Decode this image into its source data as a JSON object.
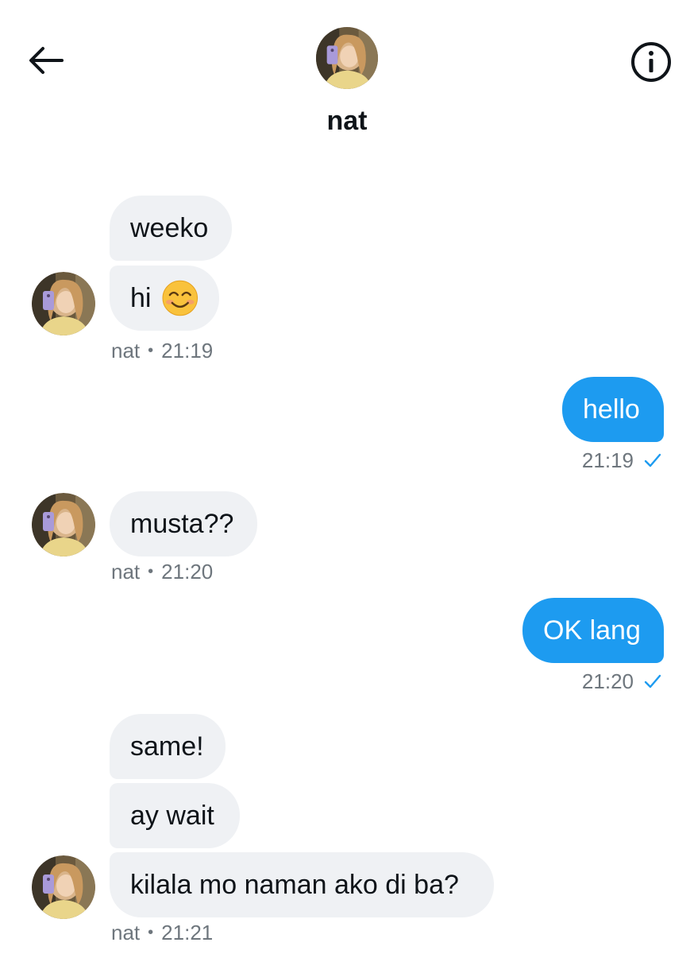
{
  "header": {
    "contact_name": "nat",
    "back_icon": "arrow-left-icon",
    "info_icon": "info-circle-icon"
  },
  "colors": {
    "outgoing_bubble": "#1d9bf0",
    "incoming_bubble": "#eff1f4",
    "meta_text": "#6e767d",
    "read_check": "#1d9bf0"
  },
  "messages": [
    {
      "direction": "in",
      "text": "weeko"
    },
    {
      "direction": "in",
      "text": "hi",
      "emoji": "smiling-face-icon"
    },
    {
      "direction": "in",
      "meta": {
        "sender": "nat",
        "time": "21:19"
      }
    },
    {
      "direction": "out",
      "text": "hello",
      "meta": {
        "time": "21:19",
        "status": "sent"
      }
    },
    {
      "direction": "in",
      "text": "musta??",
      "meta": {
        "sender": "nat",
        "time": "21:20"
      }
    },
    {
      "direction": "out",
      "text": "OK lang",
      "meta": {
        "time": "21:20",
        "status": "sent"
      }
    },
    {
      "direction": "in",
      "text": "same!"
    },
    {
      "direction": "in",
      "text": "ay wait"
    },
    {
      "direction": "in",
      "text": "kilala mo naman ako di ba?",
      "meta": {
        "sender": "nat",
        "time": "21:21"
      }
    }
  ]
}
